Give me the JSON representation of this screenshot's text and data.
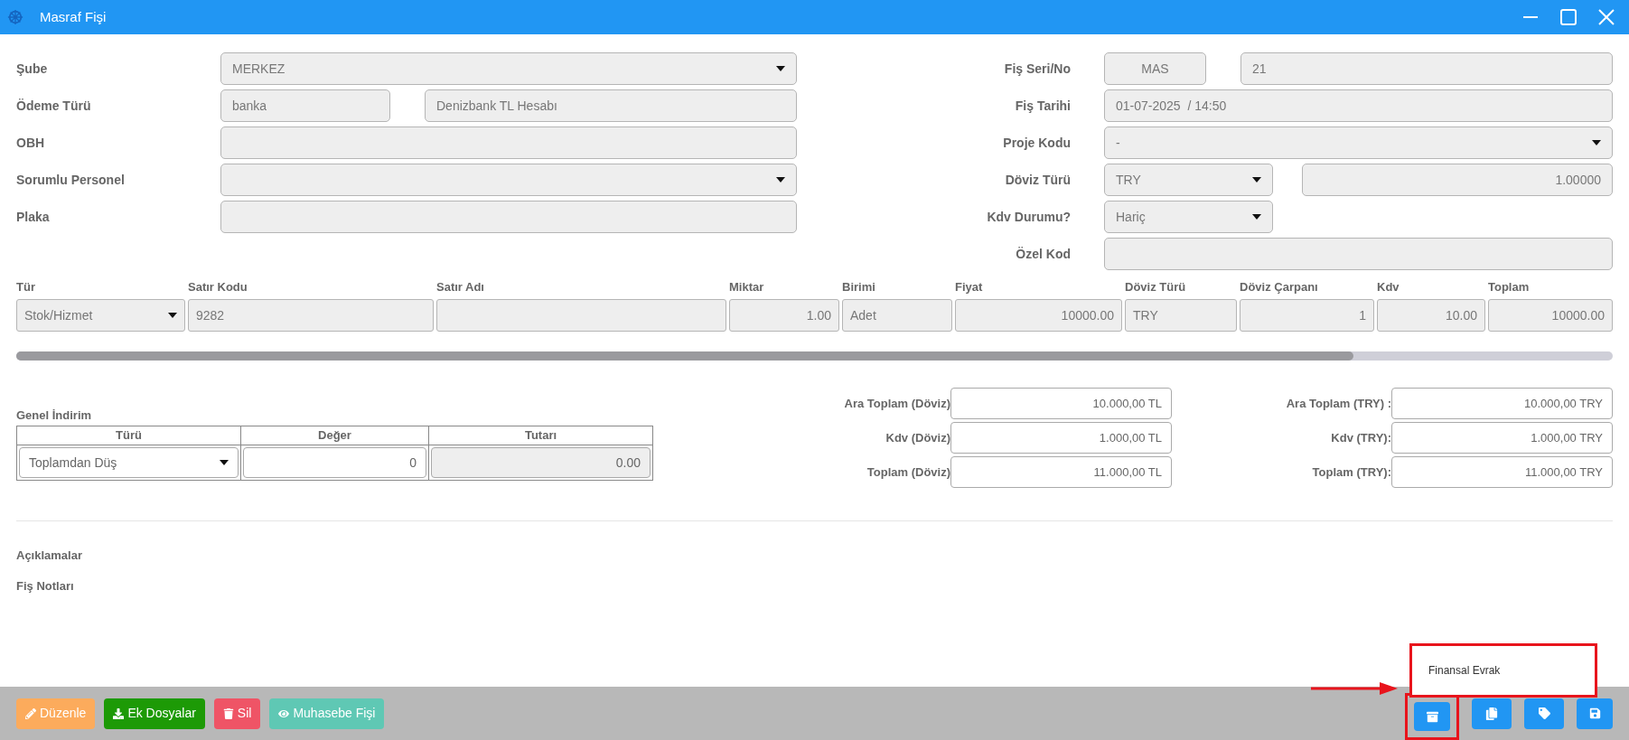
{
  "window": {
    "title": "Masraf Fişi"
  },
  "left_fields": [
    {
      "label": "Şube",
      "kind": "select",
      "value": "MERKEZ"
    },
    {
      "label": "Ödeme Türü",
      "kind": "pair",
      "value": "banka",
      "extra": "Denizbank TL Hesabı"
    },
    {
      "label": "OBH",
      "kind": "input"
    },
    {
      "label": "Sorumlu Personel",
      "kind": "select"
    },
    {
      "label": "Plaka",
      "kind": "input"
    }
  ],
  "right_fields": [
    {
      "label": "Fiş Seri/No",
      "kind": "pair",
      "value": "MAS",
      "extra": "21"
    },
    {
      "label": "Fiş Tarihi",
      "kind": "input",
      "value": "01-07-2025  / 14:50"
    },
    {
      "label": "Proje Kodu",
      "kind": "select",
      "value": "-"
    },
    {
      "label": "Döviz Türü",
      "kind": "select_pair",
      "value": "TRY",
      "extra": "1.00000"
    },
    {
      "label": "Kdv Durumu?",
      "kind": "small_select",
      "value": "Hariç"
    },
    {
      "label": "Özel Kod",
      "kind": "input"
    }
  ],
  "lines": {
    "columns": [
      "Tür",
      "Satır Kodu",
      "Satır Adı",
      "Miktar",
      "Birimi",
      "Fiyat",
      "Döviz Türü",
      "Döviz Çarpanı",
      "Kdv",
      "Toplam"
    ],
    "rows": [
      [
        {
          "kind": "select",
          "value": "Stok/Hizmet"
        },
        {
          "kind": "text",
          "value": "9282"
        },
        {
          "kind": "text"
        },
        {
          "kind": "number",
          "value": "1.00"
        },
        {
          "kind": "text",
          "value": "Adet"
        },
        {
          "kind": "number",
          "value": "10000.00"
        },
        {
          "kind": "text",
          "value": "TRY"
        },
        {
          "kind": "number",
          "value": "1"
        },
        {
          "kind": "number",
          "value": "10.00"
        },
        {
          "kind": "number",
          "value": "10000.00"
        }
      ]
    ]
  },
  "discount": {
    "title": "Genel İndirim",
    "columns": [
      "Türü",
      "Değer",
      "Tutarı"
    ],
    "cells": [
      {
        "kind": "select",
        "value": "Toplamdan Düş"
      },
      {
        "kind": "input",
        "value": "0"
      },
      {
        "kind": "readonly",
        "value": "0.00"
      }
    ]
  },
  "totals_doviz": [
    {
      "label": "Ara Toplam (Döviz)",
      "value": "10.000,00 TL"
    },
    {
      "label": "Kdv (Döviz)",
      "value": "1.000,00 TL"
    },
    {
      "label": "Toplam (Döviz)",
      "value": "11.000,00 TL"
    }
  ],
  "totals_try": [
    {
      "label": "Ara Toplam (TRY) :",
      "value": "10.000,00 TRY"
    },
    {
      "label": "Kdv (TRY):",
      "value": "1.000,00 TRY"
    },
    {
      "label": "Toplam (TRY):",
      "value": "11.000,00 TRY"
    }
  ],
  "sections": [
    "Açıklamalar",
    "Fiş Notları"
  ],
  "popup": {
    "items": [
      "Finansal Evrak"
    ]
  },
  "actions": [
    {
      "label": "Düzenle",
      "color": "#fcab5c"
    },
    {
      "label": "Ek Dosyalar",
      "color": "#1d9a06"
    },
    {
      "label": "Sil",
      "color": "#ef5466"
    },
    {
      "label": "Muhasebe Fişi",
      "color": "#5fc8b4"
    }
  ]
}
